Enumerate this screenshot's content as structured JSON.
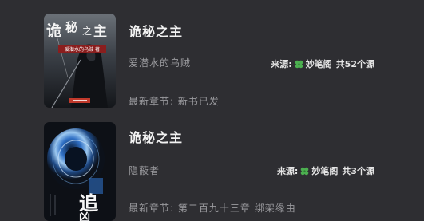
{
  "books": [
    {
      "title": "诡秘之主",
      "author": "爱潜水的乌贼",
      "source_label": "来源:",
      "source_name": "妙笔阁",
      "source_count": "共52个源",
      "latest_chapter_label": "最新章节:",
      "latest_chapter": "新书已发",
      "cover_title": "诡秘之主",
      "cover_subtitle": "爱潜水的乌贼·著"
    },
    {
      "title": "诡秘之主",
      "author": "隐蔽者",
      "source_label": "来源:",
      "source_name": "妙笔阁",
      "source_count": "共3个源",
      "latest_chapter_label": "最新章节:",
      "latest_chapter": "第二百九十三章 绑架缘由",
      "cover_title": "追凶"
    }
  ],
  "colors": {
    "background": "#2e2e32",
    "title": "#f2f2f2",
    "secondary_text": "#9a9a9e",
    "clover": "#4caf50"
  },
  "icons": {
    "source": "clover-icon"
  }
}
